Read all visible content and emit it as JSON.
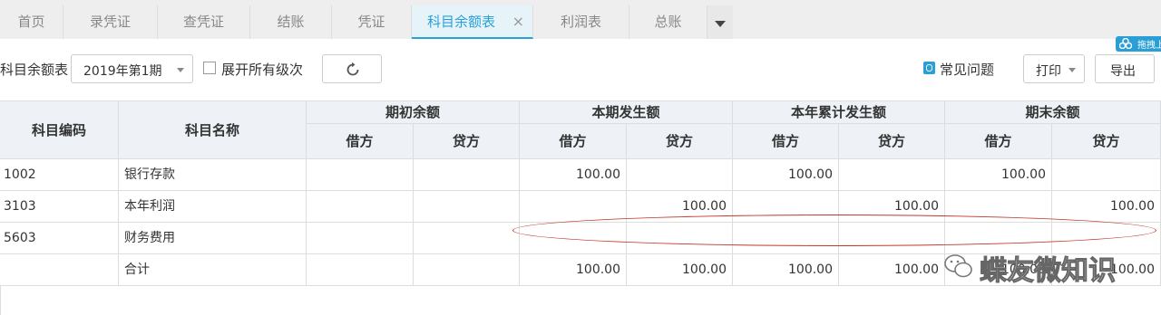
{
  "tabs": [
    {
      "label": "首页"
    },
    {
      "label": "录凭证"
    },
    {
      "label": "查凭证"
    },
    {
      "label": "结账"
    },
    {
      "label": "凭证"
    },
    {
      "label": "科目余额表",
      "close": "×"
    },
    {
      "label": "利润表"
    },
    {
      "label": "总账"
    }
  ],
  "toolbar": {
    "report_label": "科目余额表",
    "period_value": "2019年第1期",
    "expand_all_label": "展开所有级次",
    "expand_all_checked": false,
    "faq_label": "常见问题",
    "print_label": "打印",
    "export_label": "导出",
    "drag_badge_text": "拖拽上"
  },
  "table": {
    "col_code": "科目编码",
    "col_name": "科目名称",
    "groups": [
      "期初余额",
      "本期发生额",
      "本年累计发生额",
      "期末余额"
    ],
    "sub_debit": "借方",
    "sub_credit": "贷方",
    "rows": [
      {
        "code": "1002",
        "name": "银行存款",
        "v": [
          "",
          "",
          "100.00",
          "",
          "100.00",
          "",
          "100.00",
          ""
        ]
      },
      {
        "code": "3103",
        "name": "本年利润",
        "v": [
          "",
          "",
          "",
          "100.00",
          "",
          "100.00",
          "",
          "100.00"
        ]
      },
      {
        "code": "5603",
        "name": "财务费用",
        "v": [
          "",
          "",
          "",
          "",
          "",
          "",
          "",
          ""
        ]
      },
      {
        "code": "",
        "name": "合计",
        "v": [
          "",
          "",
          "100.00",
          "100.00",
          "100.00",
          "100.00",
          "100.00",
          "100.00"
        ]
      }
    ]
  },
  "watermark": {
    "text": "蝶友微知识"
  },
  "colors": {
    "accent": "#2aa0d8",
    "annotation": "#c0392b"
  }
}
